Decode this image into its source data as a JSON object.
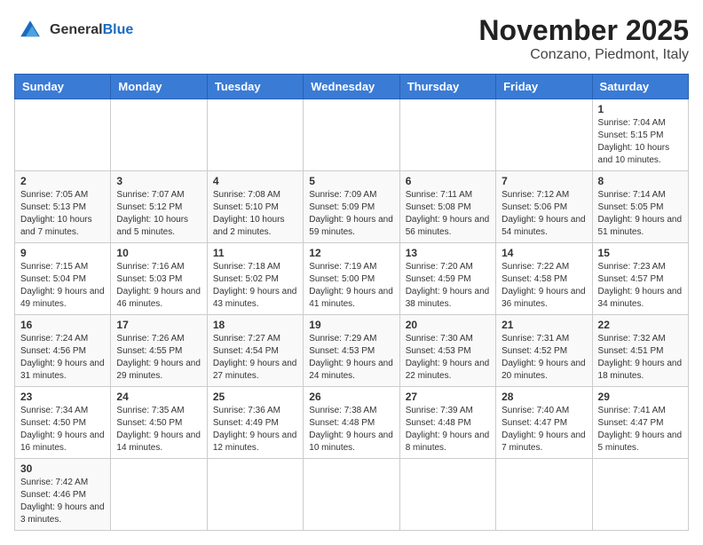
{
  "header": {
    "logo_general": "General",
    "logo_blue": "Blue",
    "title": "November 2025",
    "subtitle": "Conzano, Piedmont, Italy"
  },
  "weekdays": [
    "Sunday",
    "Monday",
    "Tuesday",
    "Wednesday",
    "Thursday",
    "Friday",
    "Saturday"
  ],
  "weeks": [
    [
      {
        "day": "",
        "info": ""
      },
      {
        "day": "",
        "info": ""
      },
      {
        "day": "",
        "info": ""
      },
      {
        "day": "",
        "info": ""
      },
      {
        "day": "",
        "info": ""
      },
      {
        "day": "",
        "info": ""
      },
      {
        "day": "1",
        "info": "Sunrise: 7:04 AM\nSunset: 5:15 PM\nDaylight: 10 hours and 10 minutes."
      }
    ],
    [
      {
        "day": "2",
        "info": "Sunrise: 7:05 AM\nSunset: 5:13 PM\nDaylight: 10 hours and 7 minutes."
      },
      {
        "day": "3",
        "info": "Sunrise: 7:07 AM\nSunset: 5:12 PM\nDaylight: 10 hours and 5 minutes."
      },
      {
        "day": "4",
        "info": "Sunrise: 7:08 AM\nSunset: 5:10 PM\nDaylight: 10 hours and 2 minutes."
      },
      {
        "day": "5",
        "info": "Sunrise: 7:09 AM\nSunset: 5:09 PM\nDaylight: 9 hours and 59 minutes."
      },
      {
        "day": "6",
        "info": "Sunrise: 7:11 AM\nSunset: 5:08 PM\nDaylight: 9 hours and 56 minutes."
      },
      {
        "day": "7",
        "info": "Sunrise: 7:12 AM\nSunset: 5:06 PM\nDaylight: 9 hours and 54 minutes."
      },
      {
        "day": "8",
        "info": "Sunrise: 7:14 AM\nSunset: 5:05 PM\nDaylight: 9 hours and 51 minutes."
      }
    ],
    [
      {
        "day": "9",
        "info": "Sunrise: 7:15 AM\nSunset: 5:04 PM\nDaylight: 9 hours and 49 minutes."
      },
      {
        "day": "10",
        "info": "Sunrise: 7:16 AM\nSunset: 5:03 PM\nDaylight: 9 hours and 46 minutes."
      },
      {
        "day": "11",
        "info": "Sunrise: 7:18 AM\nSunset: 5:02 PM\nDaylight: 9 hours and 43 minutes."
      },
      {
        "day": "12",
        "info": "Sunrise: 7:19 AM\nSunset: 5:00 PM\nDaylight: 9 hours and 41 minutes."
      },
      {
        "day": "13",
        "info": "Sunrise: 7:20 AM\nSunset: 4:59 PM\nDaylight: 9 hours and 38 minutes."
      },
      {
        "day": "14",
        "info": "Sunrise: 7:22 AM\nSunset: 4:58 PM\nDaylight: 9 hours and 36 minutes."
      },
      {
        "day": "15",
        "info": "Sunrise: 7:23 AM\nSunset: 4:57 PM\nDaylight: 9 hours and 34 minutes."
      }
    ],
    [
      {
        "day": "16",
        "info": "Sunrise: 7:24 AM\nSunset: 4:56 PM\nDaylight: 9 hours and 31 minutes."
      },
      {
        "day": "17",
        "info": "Sunrise: 7:26 AM\nSunset: 4:55 PM\nDaylight: 9 hours and 29 minutes."
      },
      {
        "day": "18",
        "info": "Sunrise: 7:27 AM\nSunset: 4:54 PM\nDaylight: 9 hours and 27 minutes."
      },
      {
        "day": "19",
        "info": "Sunrise: 7:29 AM\nSunset: 4:53 PM\nDaylight: 9 hours and 24 minutes."
      },
      {
        "day": "20",
        "info": "Sunrise: 7:30 AM\nSunset: 4:53 PM\nDaylight: 9 hours and 22 minutes."
      },
      {
        "day": "21",
        "info": "Sunrise: 7:31 AM\nSunset: 4:52 PM\nDaylight: 9 hours and 20 minutes."
      },
      {
        "day": "22",
        "info": "Sunrise: 7:32 AM\nSunset: 4:51 PM\nDaylight: 9 hours and 18 minutes."
      }
    ],
    [
      {
        "day": "23",
        "info": "Sunrise: 7:34 AM\nSunset: 4:50 PM\nDaylight: 9 hours and 16 minutes."
      },
      {
        "day": "24",
        "info": "Sunrise: 7:35 AM\nSunset: 4:50 PM\nDaylight: 9 hours and 14 minutes."
      },
      {
        "day": "25",
        "info": "Sunrise: 7:36 AM\nSunset: 4:49 PM\nDaylight: 9 hours and 12 minutes."
      },
      {
        "day": "26",
        "info": "Sunrise: 7:38 AM\nSunset: 4:48 PM\nDaylight: 9 hours and 10 minutes."
      },
      {
        "day": "27",
        "info": "Sunrise: 7:39 AM\nSunset: 4:48 PM\nDaylight: 9 hours and 8 minutes."
      },
      {
        "day": "28",
        "info": "Sunrise: 7:40 AM\nSunset: 4:47 PM\nDaylight: 9 hours and 7 minutes."
      },
      {
        "day": "29",
        "info": "Sunrise: 7:41 AM\nSunset: 4:47 PM\nDaylight: 9 hours and 5 minutes."
      }
    ],
    [
      {
        "day": "30",
        "info": "Sunrise: 7:42 AM\nSunset: 4:46 PM\nDaylight: 9 hours and 3 minutes."
      },
      {
        "day": "",
        "info": ""
      },
      {
        "day": "",
        "info": ""
      },
      {
        "day": "",
        "info": ""
      },
      {
        "day": "",
        "info": ""
      },
      {
        "day": "",
        "info": ""
      },
      {
        "day": "",
        "info": ""
      }
    ]
  ]
}
